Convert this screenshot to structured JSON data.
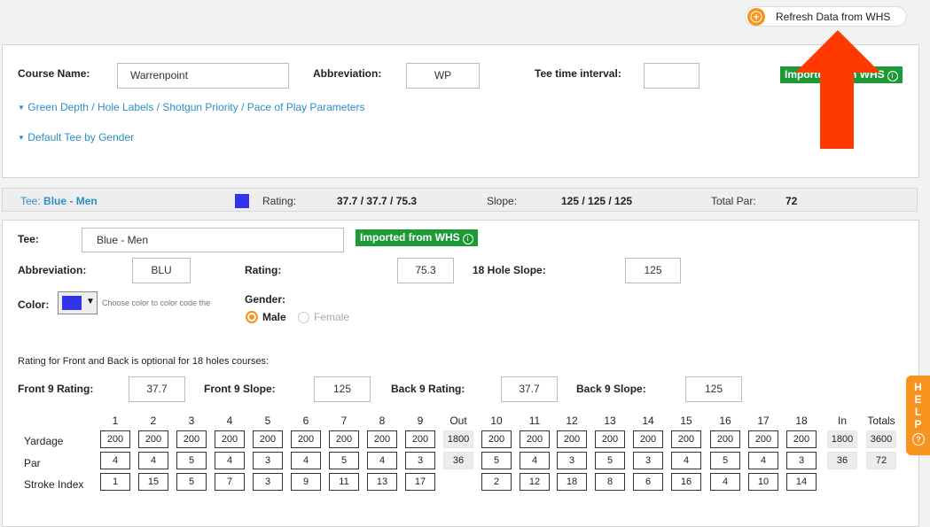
{
  "refresh_button": {
    "label": "Refresh Data from WHS",
    "icon": "plus-circle-icon"
  },
  "course": {
    "name_label": "Course Name:",
    "name_value": "Warrenpoint",
    "abbr_label": "Abbreviation:",
    "abbr_value": "WP",
    "tee_interval_label": "Tee time interval:",
    "tee_interval_value": "",
    "imported_badge": "Imported from WHS",
    "link_params": "Green Depth / Hole Labels / Shotgun Priority / Pace of Play Parameters",
    "link_default_tee": "Default Tee by Gender"
  },
  "tee_bar": {
    "tee_label": "Tee:",
    "tee_name": "Blue - Men",
    "swatch_color": "#3333ee",
    "rating_label": "Rating:",
    "rating_value": "37.7 / 37.7 / 75.3",
    "slope_label": "Slope:",
    "slope_value": "125 / 125 / 125",
    "total_par_label": "Total Par:",
    "total_par_value": "72"
  },
  "tee_form": {
    "tee_label": "Tee:",
    "tee_value": "Blue - Men",
    "imported_badge": "Imported from WHS",
    "abbr_label": "Abbreviation:",
    "abbr_value": "BLU",
    "rating_label": "Rating:",
    "rating_value": "75.3",
    "slope_label": "18 Hole Slope:",
    "slope_value": "125",
    "color_label": "Color:",
    "color_value": "#3333ee",
    "color_hint": "Choose color to color code the",
    "gender_label": "Gender:",
    "gender_options": [
      "Male",
      "Female"
    ],
    "gender_selected": "Male",
    "optional_note": "Rating for Front and Back is optional for 18 holes courses:",
    "front9_rating_label": "Front 9 Rating:",
    "front9_rating_value": "37.7",
    "front9_slope_label": "Front 9 Slope:",
    "front9_slope_value": "125",
    "back9_rating_label": "Back 9 Rating:",
    "back9_rating_value": "37.7",
    "back9_slope_label": "Back 9 Slope:",
    "back9_slope_value": "125"
  },
  "scorecard": {
    "row_labels": [
      "Yardage",
      "Par",
      "Stroke Index"
    ],
    "columns": [
      {
        "h": "1",
        "y": "200",
        "p": "4",
        "s": "1"
      },
      {
        "h": "2",
        "y": "200",
        "p": "4",
        "s": "15"
      },
      {
        "h": "3",
        "y": "200",
        "p": "5",
        "s": "5"
      },
      {
        "h": "4",
        "y": "200",
        "p": "4",
        "s": "7"
      },
      {
        "h": "5",
        "y": "200",
        "p": "3",
        "s": "3"
      },
      {
        "h": "6",
        "y": "200",
        "p": "4",
        "s": "9"
      },
      {
        "h": "7",
        "y": "200",
        "p": "5",
        "s": "11"
      },
      {
        "h": "8",
        "y": "200",
        "p": "4",
        "s": "13"
      },
      {
        "h": "9",
        "y": "200",
        "p": "3",
        "s": "17"
      },
      {
        "h": "Out",
        "y": "1800",
        "p": "36",
        "s": "",
        "total": true
      },
      {
        "h": "10",
        "y": "200",
        "p": "5",
        "s": "2"
      },
      {
        "h": "11",
        "y": "200",
        "p": "4",
        "s": "12"
      },
      {
        "h": "12",
        "y": "200",
        "p": "3",
        "s": "18"
      },
      {
        "h": "13",
        "y": "200",
        "p": "5",
        "s": "8"
      },
      {
        "h": "14",
        "y": "200",
        "p": "3",
        "s": "6"
      },
      {
        "h": "15",
        "y": "200",
        "p": "4",
        "s": "16"
      },
      {
        "h": "16",
        "y": "200",
        "p": "5",
        "s": "4"
      },
      {
        "h": "17",
        "y": "200",
        "p": "4",
        "s": "10"
      },
      {
        "h": "18",
        "y": "200",
        "p": "3",
        "s": "14"
      },
      {
        "h": "In",
        "y": "1800",
        "p": "36",
        "s": "",
        "total": true
      },
      {
        "h": "Totals",
        "y": "3600",
        "p": "72",
        "s": "",
        "total": true
      }
    ]
  },
  "help_tab": {
    "label": "HELP",
    "icon": "question-circle-icon"
  },
  "colors": {
    "accent": "#f7931e",
    "link": "#2a8ec8",
    "badge": "#1c9a36",
    "arrow": "#ff3a00"
  }
}
